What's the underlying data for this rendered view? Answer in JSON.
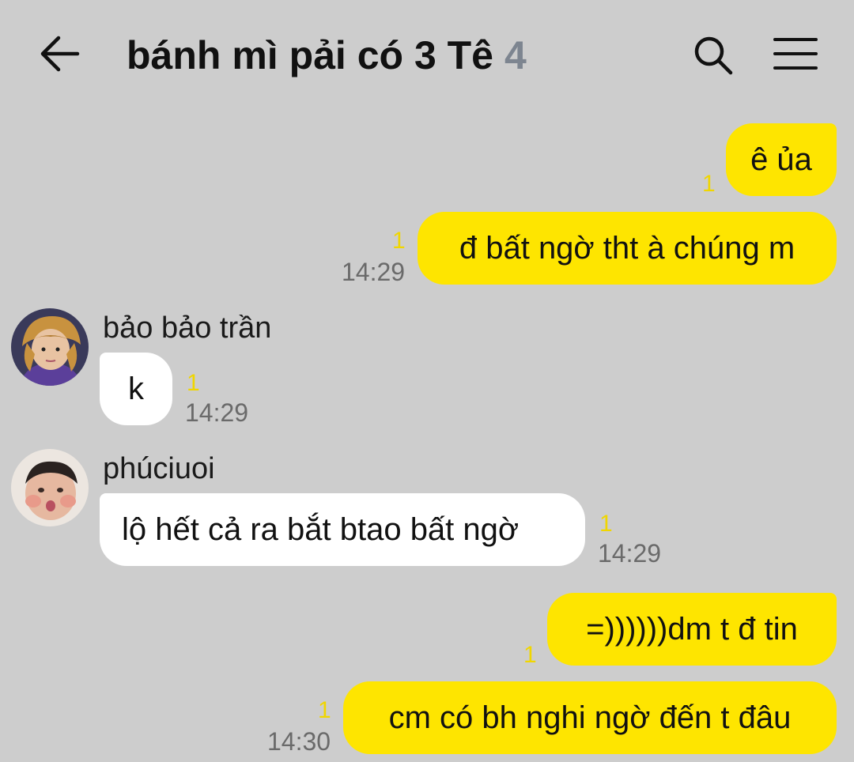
{
  "header": {
    "title": "bánh mì pải có 3 Tê",
    "member_count": "4"
  },
  "messages": [
    {
      "text": "ê ủa",
      "unread": "1",
      "time": ""
    },
    {
      "text": "đ bất ngờ tht à chúng m",
      "unread": "1",
      "time": "14:29"
    },
    {
      "sender": "bảo bảo trần",
      "text": "k",
      "unread": "1",
      "time": "14:29"
    },
    {
      "sender": "phúciuoi",
      "text": "lộ hết cả ra bắt btao bất ngờ",
      "unread": "1",
      "time": "14:29"
    },
    {
      "text": "=))))))dm t đ tin",
      "unread": "1",
      "time": ""
    },
    {
      "text": "cm có bh nghi ngờ đến t đâu",
      "unread": "1",
      "time": "14:30"
    }
  ],
  "colors": {
    "background": "#cdcdcd",
    "my_bubble": "#fee500",
    "other_bubble": "#ffffff",
    "unread": "#f0d600",
    "member_count": "#7d8590"
  },
  "icons": [
    "back-arrow-icon",
    "search-icon",
    "menu-icon"
  ]
}
